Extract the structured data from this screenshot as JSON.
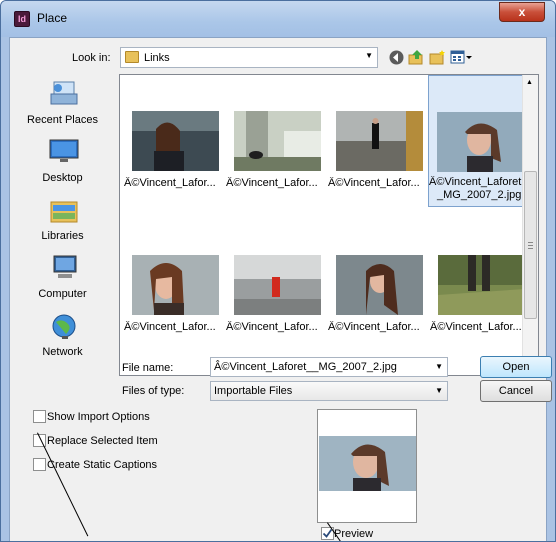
{
  "window": {
    "title": "Place",
    "app_icon_text": "Id",
    "close_label": "x"
  },
  "toolbar": {
    "look_in_label": "Look in:",
    "look_in_value": "Links",
    "icons": [
      "back-icon",
      "up-folder-icon",
      "new-folder-icon",
      "view-menu-icon"
    ]
  },
  "places": [
    {
      "label": "Recent Places",
      "icon": "recent-places-icon"
    },
    {
      "label": "Desktop",
      "icon": "desktop-icon"
    },
    {
      "label": "Libraries",
      "icon": "libraries-icon"
    },
    {
      "label": "Computer",
      "icon": "computer-icon"
    },
    {
      "label": "Network",
      "icon": "network-icon"
    }
  ],
  "files": [
    {
      "name": "Â©Vincent_Lafor..."
    },
    {
      "name": "Â©Vincent_Lafor..."
    },
    {
      "name": "Â©Vincent_Lafor..."
    },
    {
      "name": "Â©Vincent_Laforet",
      "name2": "_MG_2007_2.jpg",
      "selected": true
    },
    {
      "name": "Â©Vincent_Lafor..."
    },
    {
      "name": "Â©Vincent_Lafor..."
    },
    {
      "name": "Â©Vincent_Lafor..."
    },
    {
      "name": "Â©Vincent_Lafor..."
    }
  ],
  "file_name": {
    "label": "File name:",
    "value": "Â©Vincent_Laforet__MG_2007_2.jpg"
  },
  "files_of_type": {
    "label": "Files of type:",
    "value": "Importable Files"
  },
  "buttons": {
    "open": "Open",
    "cancel": "Cancel"
  },
  "options": {
    "show_import_options": "Show Import Options",
    "replace_selected_item": "Replace Selected Item",
    "create_static_captions": "Create Static Captions"
  },
  "preview": {
    "label": "Preview",
    "checked": true
  },
  "colors": {
    "accent": "#3c7fb1",
    "selection": "#dce9f8",
    "titlebar": "#aac6e8"
  }
}
